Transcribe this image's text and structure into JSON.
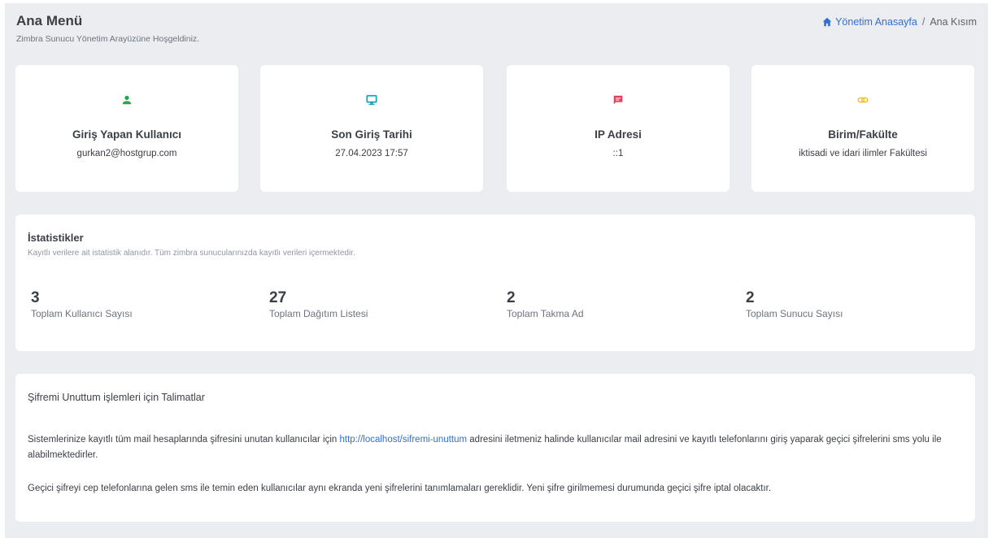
{
  "header": {
    "title": "Ana Menü",
    "subtitle": "Zimbra Sunucu Yönetim Arayüzüne Hoşgeldiniz.",
    "breadcrumb": {
      "home_label": "Yönetim Anasayfa",
      "separator": "/",
      "current": "Ana Kısım"
    }
  },
  "cards": [
    {
      "icon": "user-icon",
      "color": "#28a745",
      "title": "Giriş Yapan Kullanıcı",
      "value": "gurkan2@hostgrup.com"
    },
    {
      "icon": "monitor-icon",
      "color": "#17a2b8",
      "title": "Son Giriş Tarihi",
      "value": "27.04.2023 17:57"
    },
    {
      "icon": "message-icon",
      "color": "#e83e5a",
      "title": "IP Adresi",
      "value": "::1"
    },
    {
      "icon": "link-icon",
      "color": "#f0c020",
      "title": "Birim/Fakülte",
      "value": "iktisadi ve idari ilimler Fakültesi"
    }
  ],
  "stats": {
    "title": "İstatistikler",
    "description": "Kayıtlı verilere ait istatistik alanıdır. Tüm zimbra sunucularınızda kayıtlı verileri içermektedir.",
    "items": [
      {
        "value": "3",
        "label": "Toplam Kullanıcı Sayısı"
      },
      {
        "value": "27",
        "label": "Toplam Dağıtım Listesi"
      },
      {
        "value": "2",
        "label": "Toplam Takma Ad"
      },
      {
        "value": "2",
        "label": "Toplam Sunucu Sayısı"
      }
    ]
  },
  "instructions": {
    "title": "Şifremi Unuttum işlemleri için Talimatlar",
    "p1_before": "Sistemlerinize kayıtlı tüm mail hesaplarında şifresini unutan kullanıcılar için ",
    "p1_link": "http://localhost/sifremi-unuttum",
    "p1_after": " adresini iletmeniz halinde kullanıcılar mail adresini ve kayıtlı telefonlarını giriş yaparak geçici şifrelerini sms yolu ile alabilmektedirler.",
    "p2": "Geçici şifreyi cep telefonlarına gelen sms ile temin eden kullanıcılar aynı ekranda yeni şifrelerini tanımlamaları gereklidir. Yeni şifre girilmemesi durumunda geçici şifre iptal olacaktır."
  }
}
